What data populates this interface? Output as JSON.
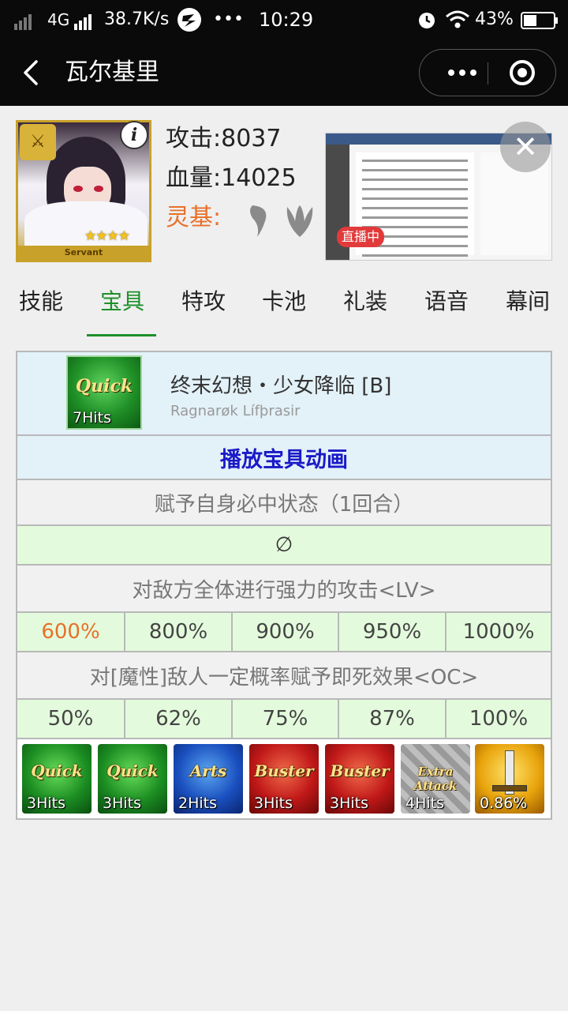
{
  "status_bar": {
    "network": "4G",
    "speed": "38.7K/s",
    "more": "•••",
    "time": "10:29",
    "battery": "43%"
  },
  "nav": {
    "title": "瓦尔基里"
  },
  "servant": {
    "attack_label": "攻击:",
    "attack": "8037",
    "hp_label": "血量:",
    "hp": "14025",
    "lingji_label": "灵基:",
    "card_label": "Servant",
    "stars": "★★★★",
    "info_icon": "i"
  },
  "live": {
    "badge": "直播中",
    "close": "✕"
  },
  "tabs": [
    {
      "label": "技能",
      "active": false
    },
    {
      "label": "宝具",
      "active": true
    },
    {
      "label": "特攻",
      "active": false
    },
    {
      "label": "卡池",
      "active": false
    },
    {
      "label": "礼装",
      "active": false
    },
    {
      "label": "语音",
      "active": false
    },
    {
      "label": "幕间",
      "active": false
    }
  ],
  "noble_phantasm": {
    "card_type": "Quick",
    "card_hits": "7Hits",
    "name": "终末幻想・少女降临 [B]",
    "romanized": "Ragnarøk Lífþrasir",
    "play_animation": "播放宝具动画",
    "effect1": "赋予自身必中状态（1回合）",
    "effect1_value": "∅",
    "effect2": "对敌方全体进行强力的攻击<LV>",
    "effect2_values": [
      "600%",
      "800%",
      "900%",
      "950%",
      "1000%"
    ],
    "effect3": "对[魔性]敌人一定概率赋予即死效果<OC>",
    "effect3_values": [
      "50%",
      "62%",
      "75%",
      "87%",
      "100%"
    ],
    "highlight_color": "#e8702a"
  },
  "cards": [
    {
      "type": "Quick",
      "hits": "3Hits"
    },
    {
      "type": "Quick",
      "hits": "3Hits"
    },
    {
      "type": "Arts",
      "hits": "2Hits"
    },
    {
      "type": "Buster",
      "hits": "3Hits"
    },
    {
      "type": "Buster",
      "hits": "3Hits"
    },
    {
      "type": "Extra Attack",
      "hits": "4Hits"
    },
    {
      "type": "NP",
      "hits": "0.86%"
    }
  ]
}
